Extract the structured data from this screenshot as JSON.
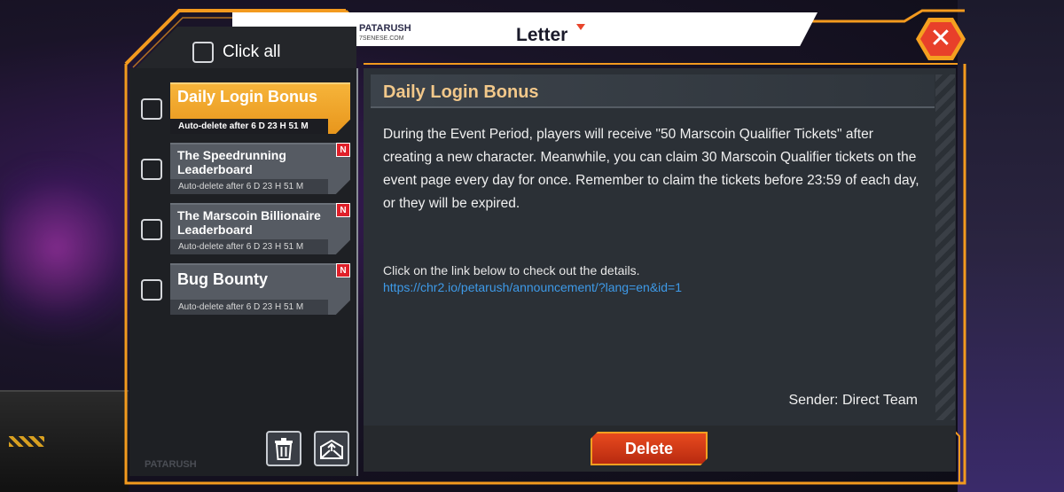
{
  "header": {
    "brand": "PATARUSH",
    "brand_sub": "7SENESE.COM",
    "title": "Letter"
  },
  "list": {
    "click_all_label": "Click all",
    "items": [
      {
        "title": "Daily Login Bonus",
        "expiry": "Auto-delete after 6 D 23 H 51 M",
        "is_new": false,
        "selected": true
      },
      {
        "title": "The Speedrunning Leaderboard",
        "expiry": "Auto-delete after 6 D 23 H 51 M",
        "is_new": true,
        "selected": false
      },
      {
        "title": "The Marscoin Billionaire Leaderboard",
        "expiry": "Auto-delete after 6 D 23 H 51 M",
        "is_new": true,
        "selected": false
      },
      {
        "title": "Bug Bounty",
        "expiry": "Auto-delete after 6 D 23 H 51 M",
        "is_new": true,
        "selected": false
      }
    ],
    "new_badge": "N",
    "watermark": "PATARUSH"
  },
  "message": {
    "subject": "Daily Login Bonus",
    "body": "During the Event Period, players will receive \"50 Marscoin Qualifier Tickets\" after creating a new character. Meanwhile, you can claim 30 Marscoin Qualifier tickets on the event page every day for once. Remember to claim the tickets before 23:59 of each day, or they will be expired.",
    "link_intro": "Click on the link below to check out the details.",
    "link": "https://chr2.io/petarush/announcement/?lang=en&id=1",
    "sender": "Sender: Direct Team"
  },
  "actions": {
    "delete_label": "Delete",
    "close_symbol": "✕"
  },
  "colors": {
    "accent": "#f39a1e",
    "danger": "#e8452c",
    "subject": "#f2c88a",
    "link": "#3e9ae8"
  }
}
